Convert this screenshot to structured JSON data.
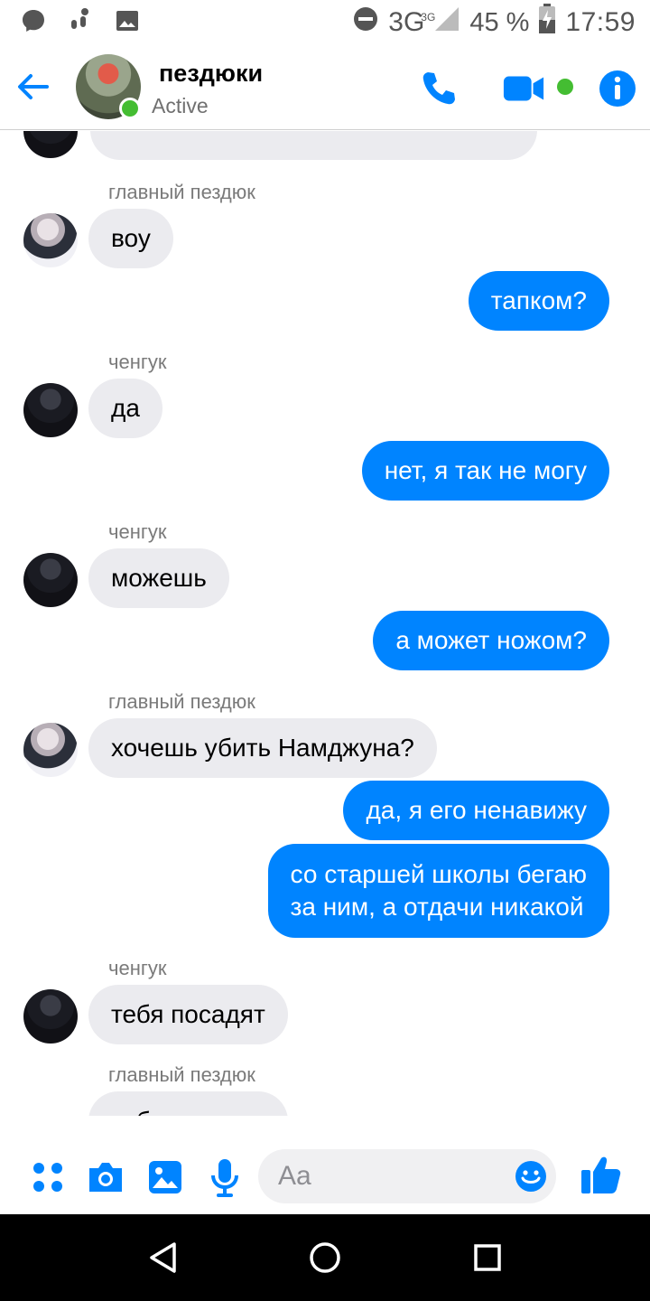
{
  "status_bar": {
    "network": "3G",
    "network_sup": "3G",
    "battery": "45 %",
    "time": "17:59",
    "icons": [
      "messenger-notification-icon",
      "walk-icon",
      "image-icon",
      "do-not-disturb-icon",
      "signal-icon",
      "battery-charging-icon"
    ]
  },
  "header": {
    "title": "пездюки",
    "status": "Active",
    "accent": "#0084ff",
    "active_color": "#44bd32"
  },
  "messages": [
    {
      "sender": "главный пездюк",
      "text": "воу",
      "dir": "in",
      "avatar": "a"
    },
    {
      "text": "тапком?",
      "dir": "out"
    },
    {
      "sender": "ченгук",
      "text": "да",
      "dir": "in",
      "avatar": "b"
    },
    {
      "text": "нет, я так не могу",
      "dir": "out"
    },
    {
      "sender": "ченгук",
      "text": "можешь",
      "dir": "in",
      "avatar": "b"
    },
    {
      "text": "а может ножом?",
      "dir": "out"
    },
    {
      "sender": "главный пездюк",
      "text": "хочешь убить Намджуна?",
      "dir": "in",
      "avatar": "a"
    },
    {
      "text": "да, я его ненавижу",
      "dir": "out"
    },
    {
      "text": "со старшей школы бегаю\nза ним, а отдачи никакой",
      "dir": "out"
    },
    {
      "sender": "ченгук",
      "text": "тебя посадят",
      "dir": "in",
      "avatar": "b"
    },
    {
      "sender": "главный пездюк",
      "text": "тебя посадят",
      "dir": "in"
    }
  ],
  "composer": {
    "placeholder": "Aa"
  }
}
